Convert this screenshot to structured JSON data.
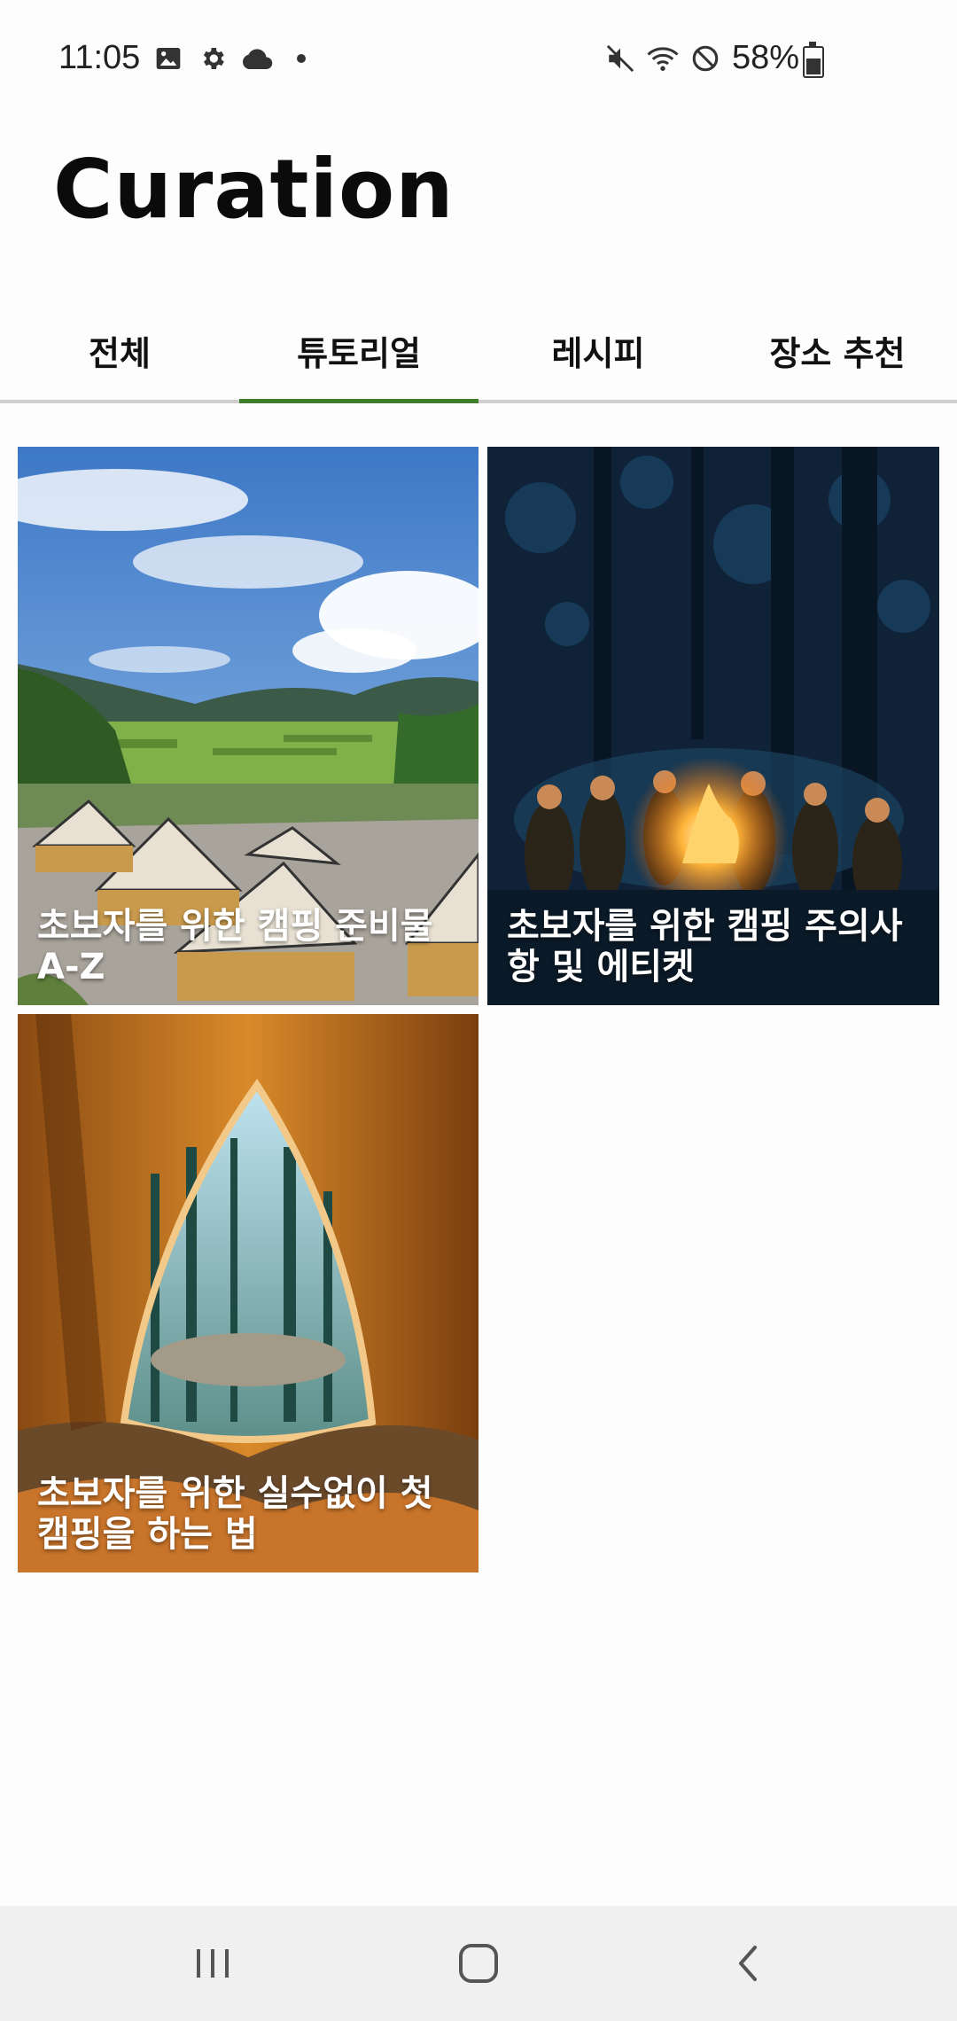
{
  "status_bar": {
    "time": "11:05",
    "left_icons": [
      "image-icon",
      "gear-icon",
      "cloud-icon",
      "dot-icon"
    ],
    "right_icons": [
      "mute-icon",
      "wifi-icon",
      "blocked-icon"
    ],
    "battery": "58%"
  },
  "header": {
    "title": "Curation"
  },
  "tabs": [
    {
      "label": "전체",
      "active": false
    },
    {
      "label": "튜토리얼",
      "active": true
    },
    {
      "label": "레시피",
      "active": false
    },
    {
      "label": "장소 추천",
      "active": false
    }
  ],
  "cards": [
    {
      "title": "초보자를 위한 캠핑 준비물 A-Z"
    },
    {
      "title": "초보자를 위한 캠핑 주의사항 및 에티켓"
    },
    {
      "title": "초보자를 위한 실수없이 첫 캠핑을 하는 법"
    }
  ],
  "colors": {
    "accent": "#3e7d2a",
    "tab_divider": "#cfcfcf",
    "navbar_bg": "#f0f0f0"
  },
  "nav_bar": {
    "buttons": [
      "recents-icon",
      "home-icon",
      "back-icon"
    ]
  }
}
